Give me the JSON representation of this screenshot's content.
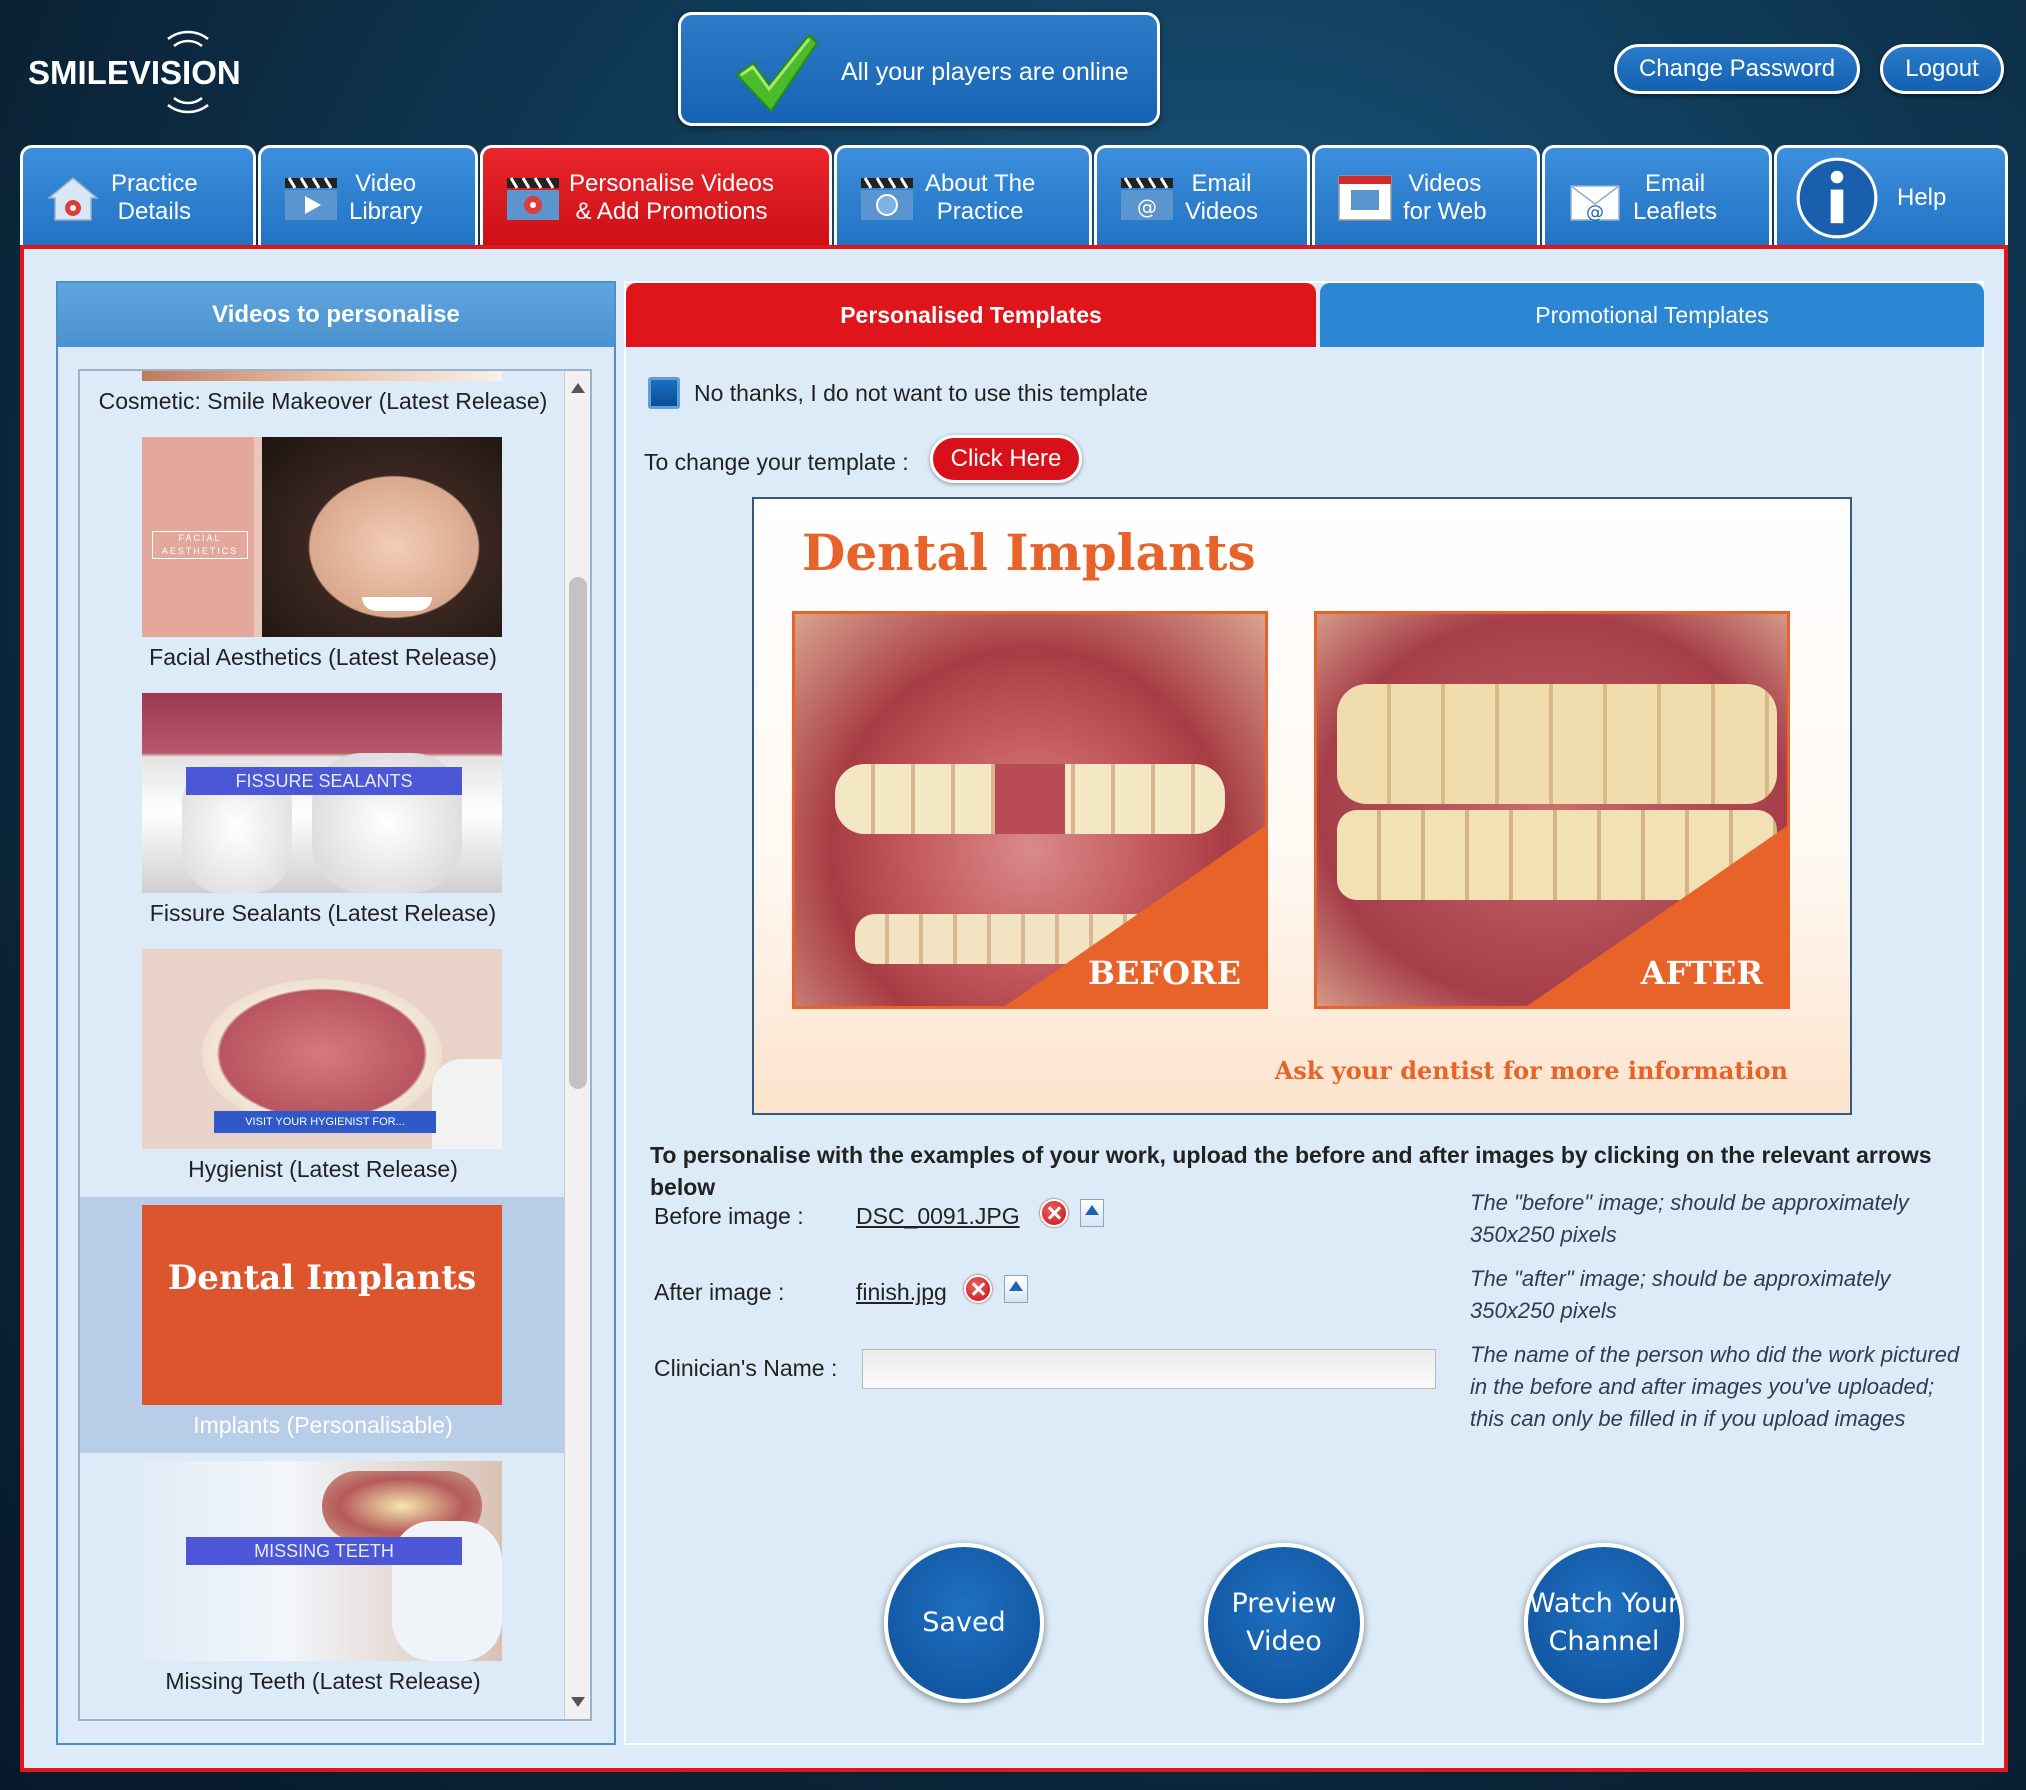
{
  "header": {
    "logo_text": "SMILEVISION",
    "status_text": "All your players are online",
    "change_password": "Change Password",
    "logout": "Logout"
  },
  "nav": [
    {
      "label": "Practice\nDetails",
      "icon": "house-gear-icon"
    },
    {
      "label": "Video\nLibrary",
      "icon": "clapperboard-play-icon"
    },
    {
      "label": "Personalise Videos\n& Add Promotions",
      "icon": "clapperboard-gear-icon",
      "active": true
    },
    {
      "label": "About The\nPractice",
      "icon": "clapperboard-globe-icon"
    },
    {
      "label": "Email\nVideos",
      "icon": "clapperboard-at-icon"
    },
    {
      "label": "Videos\nfor Web",
      "icon": "browser-window-icon"
    },
    {
      "label": "Email\nLeaflets",
      "icon": "envelope-at-icon"
    },
    {
      "label": "Help",
      "icon": "info-icon"
    }
  ],
  "left_panel": {
    "title": "Videos to personalise",
    "videos": [
      {
        "caption": "Cosmetic: Smile Makeover (Latest Release)"
      },
      {
        "caption": "Facial Aesthetics (Latest Release)",
        "thumb_text": "FACIAL AESTHETICS"
      },
      {
        "caption": "Fissure Sealants (Latest Release)",
        "thumb_text": "FISSURE SEALANTS"
      },
      {
        "caption": "Hygienist (Latest Release)",
        "thumb_text": "VISIT YOUR HYGIENIST FOR..."
      },
      {
        "caption": "Implants (Personalisable)",
        "thumb_text": "Dental Implants",
        "selected": true
      },
      {
        "caption": "Missing Teeth (Latest Release)",
        "thumb_text": "MISSING TEETH"
      }
    ]
  },
  "right_panel": {
    "tabs": {
      "personalised": "Personalised Templates",
      "promotional": "Promotional Templates"
    },
    "no_thanks": "No thanks, I do not want to use this template",
    "change_template_label": "To change your template :",
    "click_here": "Click Here",
    "preview": {
      "title": "Dental Implants",
      "before_label": "BEFORE",
      "after_label": "AFTER",
      "footer": "Ask your dentist for more information"
    },
    "instructions": "To personalise with the examples of your work, upload the before and after images by clicking on the relevant arrows below",
    "before_label": "Before image :",
    "before_file": "DSC_0091.JPG",
    "before_hint": "The \"before\" image; should be approximately 350x250 pixels",
    "after_label": "After image :",
    "after_file": "finish.jpg",
    "after_hint": "The \"after\" image; should be approximately 350x250 pixels",
    "clinician_label": "Clinician's Name :",
    "clinician_value": "",
    "clinician_hint": "The name of the person who did the work pictured in the before and after images you've uploaded; this can only be filled in if you upload images",
    "buttons": {
      "saved": "Saved",
      "preview": "Preview\nVideo",
      "watch": "Watch Your\nChannel"
    }
  },
  "colors": {
    "brand_blue": "#1f6fc0",
    "active_red": "#e0151b",
    "accent_orange": "#e8632a",
    "panel_bg": "#dcebf7"
  }
}
